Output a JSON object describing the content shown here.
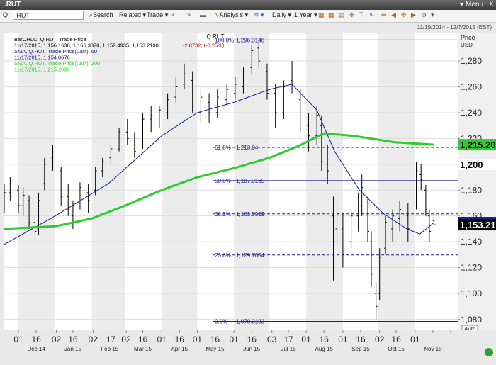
{
  "window": {
    "title": ".RUT",
    "menu_label": "Menu",
    "close_label": "x"
  },
  "toolbar": {
    "symbol_prefix": "Q",
    "symbol_value": ".RUT",
    "search": "Search",
    "related": "Related",
    "trade": "Trade",
    "analysis": "Analysis",
    "interval": "Daily",
    "range": "1 Year"
  },
  "header": {
    "date_range": "11/19/2014 - 12/7/2015 (EST)",
    "price_label": "Price",
    "currency": "USD"
  },
  "legend": [
    {
      "text": "BarOHLC, Q.RUT, Trade Price",
      "color": "#000000"
    },
    {
      "text": "11/17/2015, 1,156.1638, 1,166.3370, 1,152.4935, 1,153.2100,",
      "color": "#000000",
      "change": "-2.8732, (-0.25%)",
      "change_color": "#cc0000"
    },
    {
      "text": "SMA, Q.RUT, Trade Price(Last), 50",
      "color": "#1a1a8c"
    },
    {
      "text": "11/17/2015, 1,154.8676",
      "color": "#1a1a8c"
    },
    {
      "text": "SMA, Q.RUT, Trade Price(Last), 200",
      "color": "#2ecc2e"
    },
    {
      "text": "11/17/2015, 1,215.2004",
      "color": "#2ecc2e"
    }
  ],
  "chart_data": {
    "type": "line",
    "title": "Q.RUT",
    "x_range": [
      "2014-11-19",
      "2015-12-07"
    ],
    "ylim": [
      1080,
      1300
    ],
    "yticks": [
      1080,
      1100,
      1120,
      1140,
      1160,
      1180,
      1200,
      1220,
      1240,
      1260,
      1280
    ],
    "ytick_labels": [
      "1,080",
      "1,100",
      "1,120",
      "1,140",
      "1,160",
      "1,180",
      "1,200",
      "1,220",
      "1,240",
      "1,260",
      "1,280"
    ],
    "x_tick_labels": [
      "01",
      "16",
      "02",
      "16",
      "02",
      "17",
      "02",
      "16",
      "01",
      "16",
      "01",
      "16",
      "01",
      "16",
      "03",
      "17",
      "01",
      "16",
      "01",
      "16",
      "02",
      "16",
      "01"
    ],
    "x_tick_dates": [
      "2014-12-01",
      "2014-12-16",
      "2015-01-02",
      "2015-01-16",
      "2015-02-02",
      "2015-02-17",
      "2015-03-02",
      "2015-03-16",
      "2015-04-01",
      "2015-04-16",
      "2015-05-01",
      "2015-05-16",
      "2015-06-01",
      "2015-06-16",
      "2015-07-03",
      "2015-07-17",
      "2015-08-01",
      "2015-08-16",
      "2015-09-01",
      "2015-09-16",
      "2015-10-02",
      "2015-10-16",
      "2015-11-01",
      "2015-11-16",
      "2015-12-01"
    ],
    "month_labels": [
      "Dec 14",
      "Jan 15",
      "Feb 15",
      "Mar 15",
      "Apr 15",
      "May 15",
      "Jun 15",
      "Jul 15",
      "Aug 15",
      "Sep 15",
      "Oct 15",
      "Nov 15"
    ],
    "month_label_dates": [
      "2014-12-16",
      "2015-01-16",
      "2015-02-16",
      "2015-03-16",
      "2015-04-16",
      "2015-05-16",
      "2015-06-16",
      "2015-07-17",
      "2015-08-16",
      "2015-09-16",
      "2015-10-16",
      "2015-11-16"
    ],
    "fib_levels": [
      {
        "label": "100.0%",
        "value_label": "1,296.3146",
        "value": 1296.3146,
        "style": "solid"
      },
      {
        "label": "61.8%",
        "value_label": "1,213.04",
        "value": 1213.04,
        "style": "dashed"
      },
      {
        "label": "50.0%",
        "value_label": "1,187.3165",
        "value": 1187.3165,
        "style": "solid"
      },
      {
        "label": "38.2%",
        "value_label": "1,161.5929",
        "value": 1161.5929,
        "style": "dashed"
      },
      {
        "label": "23.6%",
        "value_label": "1,129.7654",
        "value": 1129.7654,
        "style": "dashed"
      },
      {
        "label": "0.0%",
        "value_label": "1,078.3183",
        "value": 1078.3183,
        "style": "solid"
      }
    ],
    "bars": [
      [
        "2014-11-19",
        1170,
        1185,
        1162,
        1178
      ],
      [
        "2014-11-24",
        1178,
        1190,
        1172,
        1185
      ],
      [
        "2014-12-01",
        1180,
        1184,
        1162,
        1168
      ],
      [
        "2014-12-05",
        1168,
        1182,
        1160,
        1176
      ],
      [
        "2014-12-10",
        1172,
        1176,
        1150,
        1155
      ],
      [
        "2014-12-15",
        1155,
        1160,
        1140,
        1148
      ],
      [
        "2014-12-18",
        1150,
        1178,
        1145,
        1172
      ],
      [
        "2014-12-23",
        1185,
        1205,
        1180,
        1200
      ],
      [
        "2014-12-30",
        1205,
        1215,
        1195,
        1198
      ],
      [
        "2015-01-06",
        1195,
        1198,
        1168,
        1175
      ],
      [
        "2015-01-12",
        1175,
        1185,
        1160,
        1165
      ],
      [
        "2015-01-16",
        1160,
        1172,
        1150,
        1168
      ],
      [
        "2015-01-22",
        1170,
        1186,
        1165,
        1182
      ],
      [
        "2015-01-29",
        1178,
        1185,
        1162,
        1172
      ],
      [
        "2015-02-04",
        1180,
        1198,
        1176,
        1195
      ],
      [
        "2015-02-10",
        1195,
        1205,
        1190,
        1202
      ],
      [
        "2015-02-17",
        1205,
        1215,
        1200,
        1212
      ],
      [
        "2015-02-24",
        1212,
        1228,
        1210,
        1225
      ],
      [
        "2015-03-03",
        1225,
        1235,
        1215,
        1220
      ],
      [
        "2015-03-09",
        1215,
        1225,
        1205,
        1210
      ],
      [
        "2015-03-16",
        1215,
        1240,
        1212,
        1235
      ],
      [
        "2015-03-23",
        1235,
        1245,
        1225,
        1238
      ],
      [
        "2015-03-30",
        1232,
        1245,
        1228,
        1242
      ],
      [
        "2015-04-06",
        1240,
        1255,
        1235,
        1250
      ],
      [
        "2015-04-13",
        1252,
        1268,
        1248,
        1260
      ],
      [
        "2015-04-20",
        1262,
        1278,
        1258,
        1270
      ],
      [
        "2015-04-27",
        1265,
        1272,
        1240,
        1245
      ],
      [
        "2015-05-04",
        1240,
        1258,
        1232,
        1252
      ],
      [
        "2015-05-11",
        1248,
        1255,
        1232,
        1240
      ],
      [
        "2015-05-18",
        1240,
        1258,
        1236,
        1252
      ],
      [
        "2015-05-26",
        1250,
        1262,
        1245,
        1258
      ],
      [
        "2015-06-02",
        1255,
        1268,
        1250,
        1262
      ],
      [
        "2015-06-09",
        1260,
        1275,
        1255,
        1270
      ],
      [
        "2015-06-16",
        1275,
        1292,
        1270,
        1288
      ],
      [
        "2015-06-22",
        1290,
        1296,
        1275,
        1280
      ],
      [
        "2015-06-29",
        1272,
        1278,
        1250,
        1255
      ],
      [
        "2015-07-06",
        1255,
        1262,
        1228,
        1240
      ],
      [
        "2015-07-13",
        1240,
        1265,
        1235,
        1260
      ],
      [
        "2015-07-20",
        1265,
        1280,
        1255,
        1262
      ],
      [
        "2015-07-27",
        1250,
        1258,
        1225,
        1232
      ],
      [
        "2015-08-03",
        1230,
        1240,
        1210,
        1222
      ],
      [
        "2015-08-10",
        1222,
        1245,
        1215,
        1238
      ],
      [
        "2015-08-14",
        1230,
        1238,
        1195,
        1202
      ],
      [
        "2015-08-19",
        1200,
        1215,
        1185,
        1195
      ],
      [
        "2015-08-24",
        1160,
        1175,
        1110,
        1140
      ],
      [
        "2015-08-27",
        1150,
        1172,
        1138,
        1162
      ],
      [
        "2015-09-01",
        1150,
        1162,
        1120,
        1130
      ],
      [
        "2015-09-08",
        1140,
        1165,
        1135,
        1160
      ],
      [
        "2015-09-14",
        1160,
        1178,
        1148,
        1170
      ],
      [
        "2015-09-17",
        1168,
        1192,
        1160,
        1182
      ],
      [
        "2015-09-22",
        1170,
        1175,
        1140,
        1148
      ],
      [
        "2015-09-25",
        1140,
        1148,
        1105,
        1115
      ],
      [
        "2015-09-29",
        1100,
        1108,
        1080,
        1090
      ],
      [
        "2015-10-02",
        1100,
        1135,
        1095,
        1128
      ],
      [
        "2015-10-07",
        1135,
        1160,
        1130,
        1155
      ],
      [
        "2015-10-13",
        1150,
        1165,
        1140,
        1160
      ],
      [
        "2015-10-19",
        1158,
        1172,
        1148,
        1165
      ],
      [
        "2015-10-26",
        1160,
        1170,
        1140,
        1150
      ],
      [
        "2015-11-02",
        1170,
        1202,
        1165,
        1195
      ],
      [
        "2015-11-06",
        1192,
        1200,
        1180,
        1188
      ],
      [
        "2015-11-10",
        1180,
        1184,
        1160,
        1165
      ],
      [
        "2015-11-13",
        1160,
        1165,
        1140,
        1148
      ],
      [
        "2015-11-17",
        1156.1638,
        1166.337,
        1152.4935,
        1153.21
      ]
    ],
    "series": [
      {
        "name": "SMA 50",
        "color": "#1a1a8c",
        "points": [
          [
            "2014-11-19",
            1138
          ],
          [
            "2015-01-01",
            1160
          ],
          [
            "2015-02-15",
            1185
          ],
          [
            "2015-04-01",
            1222
          ],
          [
            "2015-05-01",
            1240
          ],
          [
            "2015-06-01",
            1248
          ],
          [
            "2015-07-01",
            1258
          ],
          [
            "2015-07-20",
            1262
          ],
          [
            "2015-08-10",
            1242
          ],
          [
            "2015-08-25",
            1210
          ],
          [
            "2015-09-15",
            1180
          ],
          [
            "2015-10-05",
            1162
          ],
          [
            "2015-10-25",
            1150
          ],
          [
            "2015-11-05",
            1146
          ],
          [
            "2015-11-17",
            1154.8676
          ]
        ]
      },
      {
        "name": "SMA 200",
        "color": "#2ecc2e",
        "points": [
          [
            "2014-11-19",
            1150
          ],
          [
            "2015-01-01",
            1152
          ],
          [
            "2015-02-01",
            1158
          ],
          [
            "2015-03-01",
            1168
          ],
          [
            "2015-04-01",
            1180
          ],
          [
            "2015-05-01",
            1190
          ],
          [
            "2015-06-01",
            1197
          ],
          [
            "2015-07-01",
            1205
          ],
          [
            "2015-07-25",
            1214
          ],
          [
            "2015-08-16",
            1224
          ],
          [
            "2015-09-10",
            1222
          ],
          [
            "2015-10-15",
            1217
          ],
          [
            "2015-11-17",
            1215.2004
          ]
        ]
      }
    ],
    "price_tags": [
      {
        "text": "1,215.20",
        "value": 1215.2,
        "bg": "#2ecc2e",
        "fg": "#000000"
      },
      {
        "text": "1,200",
        "value": 1200,
        "bg": "#ffffff",
        "fg": "#000000",
        "bold": true
      },
      {
        "text": "1,154.87",
        "value": 1154.8676,
        "bg": "#1a1a8c",
        "fg": "#ffffff"
      },
      {
        "text": "1,153.21",
        "value": 1153.21,
        "bg": "#000000",
        "fg": "#ffffff"
      }
    ],
    "auto_label": "Auto",
    "colors": {
      "bars": "#000000",
      "fib": "#1a1a8c",
      "sma50": "#1a1a8c",
      "sma200": "#2ecc2e",
      "change": "#cc0000"
    }
  }
}
